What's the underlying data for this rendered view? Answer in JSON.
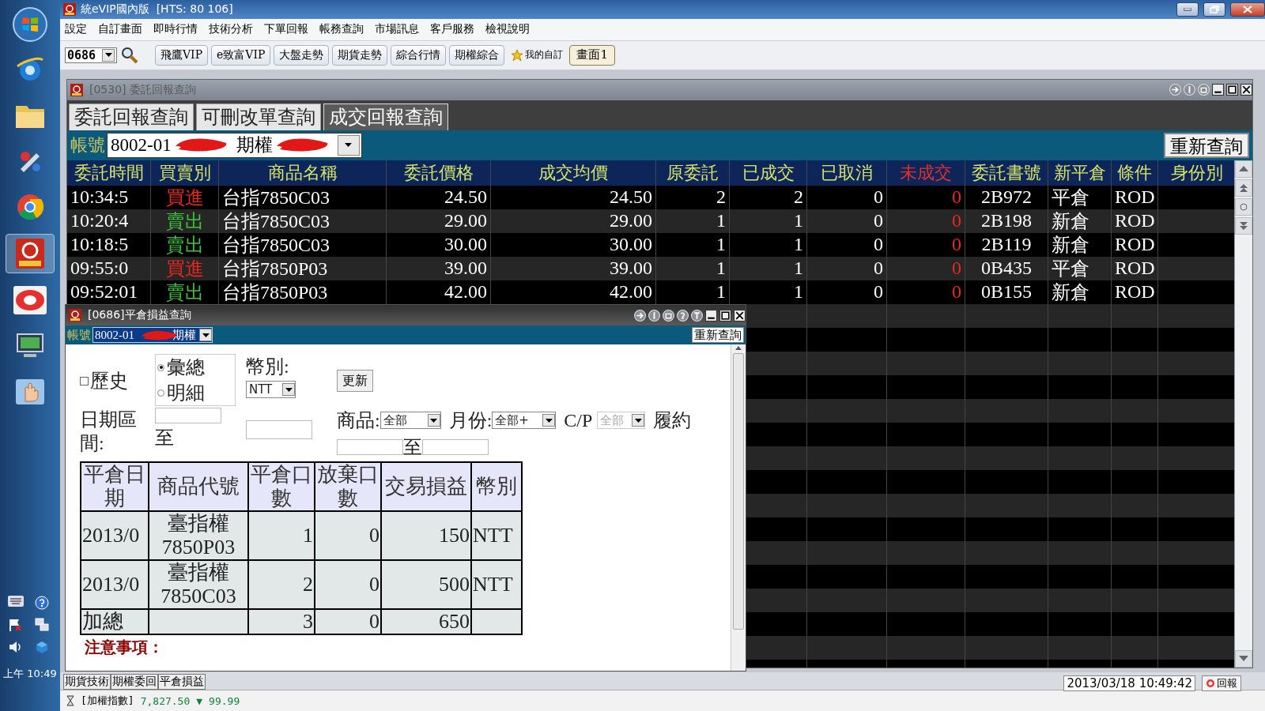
{
  "taskbar": {
    "clock": "上午 10:49"
  },
  "window": {
    "title": "統eVIP國內版  [HTS: 80 106]"
  },
  "menu": [
    "設定",
    "自訂畫面",
    "即時行情",
    "技術分析",
    "下單回報",
    "帳務查詢",
    "市場訊息",
    "客戶服務",
    "檢視說明"
  ],
  "toolbar": {
    "code": "0686",
    "buttons": [
      "飛鷹VIP",
      "e致富VIP",
      "大盤走勢",
      "期貨走勢",
      "綜合行情",
      "期權綜合"
    ],
    "favorites": "我的自訂",
    "screens": [
      {
        "label": "畫面1",
        "selected": true
      }
    ]
  },
  "order_window": {
    "title": "[0530] 委託回報查詢",
    "active": false,
    "tabs": [
      {
        "label": "委託回報查詢",
        "selected": false
      },
      {
        "label": "可刪改單查詢",
        "selected": false
      },
      {
        "label": "成交回報查詢",
        "selected": true
      }
    ],
    "account_label": "帳號",
    "account": "8002-01",
    "account_type": "期權",
    "requery": "重新查詢",
    "columns": [
      {
        "label": "委託時間",
        "alert": false
      },
      {
        "label": "買賣別",
        "alert": false
      },
      {
        "label": "商品名稱",
        "alert": false
      },
      {
        "label": "委託價格",
        "alert": false
      },
      {
        "label": "成交均價",
        "alert": false
      },
      {
        "label": "原委託",
        "alert": false
      },
      {
        "label": "已成交",
        "alert": false
      },
      {
        "label": "已取消",
        "alert": false
      },
      {
        "label": "未成交",
        "alert": true
      },
      {
        "label": "委託書號",
        "alert": false
      },
      {
        "label": "新平倉",
        "alert": false
      },
      {
        "label": "條件",
        "alert": false
      },
      {
        "label": "身份別",
        "alert": false
      }
    ],
    "rows": [
      {
        "kind": "buy",
        "cells": [
          "10:34:5",
          "買進",
          "台指7850C03",
          "24.50",
          "24.50",
          "2",
          "2",
          "0",
          "0",
          "2B972",
          "平倉",
          "ROD",
          ""
        ]
      },
      {
        "kind": "sell",
        "cells": [
          "10:20:4",
          "賣出",
          "台指7850C03",
          "29.00",
          "29.00",
          "1",
          "1",
          "0",
          "0",
          "2B198",
          "新倉",
          "ROD",
          ""
        ]
      },
      {
        "kind": "sell",
        "cells": [
          "10:18:5",
          "賣出",
          "台指7850C03",
          "30.00",
          "30.00",
          "1",
          "1",
          "0",
          "0",
          "2B119",
          "新倉",
          "ROD",
          ""
        ]
      },
      {
        "kind": "buy",
        "cells": [
          "09:55:0",
          "買進",
          "台指7850P03",
          "39.00",
          "39.00",
          "1",
          "1",
          "0",
          "0",
          "0B435",
          "平倉",
          "ROD",
          ""
        ]
      },
      {
        "kind": "sell",
        "cells": [
          "09:52:01",
          "賣出",
          "台指7850P03",
          "42.00",
          "42.00",
          "1",
          "1",
          "0",
          "0",
          "0B155",
          "新倉",
          "ROD",
          ""
        ]
      }
    ]
  },
  "pnl_window": {
    "title": "[0686]平倉損益查詢",
    "active": true,
    "account_label": "帳號",
    "account": "8002-01",
    "account_type": "期權",
    "requery": "重新查詢",
    "history": {
      "label": "歷史",
      "checked": false
    },
    "mode": [
      {
        "label": "彙總",
        "selected": true
      },
      {
        "label": "明細",
        "selected": false
      }
    ],
    "currency": {
      "label": "幣別:",
      "value": "NTT"
    },
    "update": "更新",
    "date_range": {
      "label": "日期區間:",
      "to": "至"
    },
    "product": {
      "label": "商品:",
      "value": "全部"
    },
    "month": {
      "label": "月份:",
      "value": "全部+"
    },
    "cp": {
      "label": "C/P",
      "value": "全部",
      "disabled": true
    },
    "strike": {
      "label": "履約",
      "to": "至"
    },
    "table": {
      "columns": [
        "平倉日期",
        "商品代號",
        "平倉口數",
        "放棄口數",
        "交易損益",
        "幣別"
      ],
      "rows": [
        {
          "cells": [
            "2013/0",
            [
              "臺指權",
              "7850P03"
            ],
            "1",
            "0",
            "150",
            "NTT"
          ]
        },
        {
          "cells": [
            "2013/0",
            [
              "臺指權",
              "7850C03"
            ],
            "2",
            "0",
            "500",
            "NTT"
          ]
        },
        {
          "cells": [
            "加總",
            "",
            "3",
            "0",
            "650",
            ""
          ]
        }
      ]
    },
    "note": "注意事項："
  },
  "bottom_tabs": [
    "期貨技術",
    "期權委回",
    "平倉損益"
  ],
  "status_bar": {
    "index_label": "[加權指數]",
    "index": "7,827.50",
    "arrow": "▼",
    "change": "99.99",
    "datetime": "2013/03/18 10:49:42",
    "report_button": "回報"
  }
}
